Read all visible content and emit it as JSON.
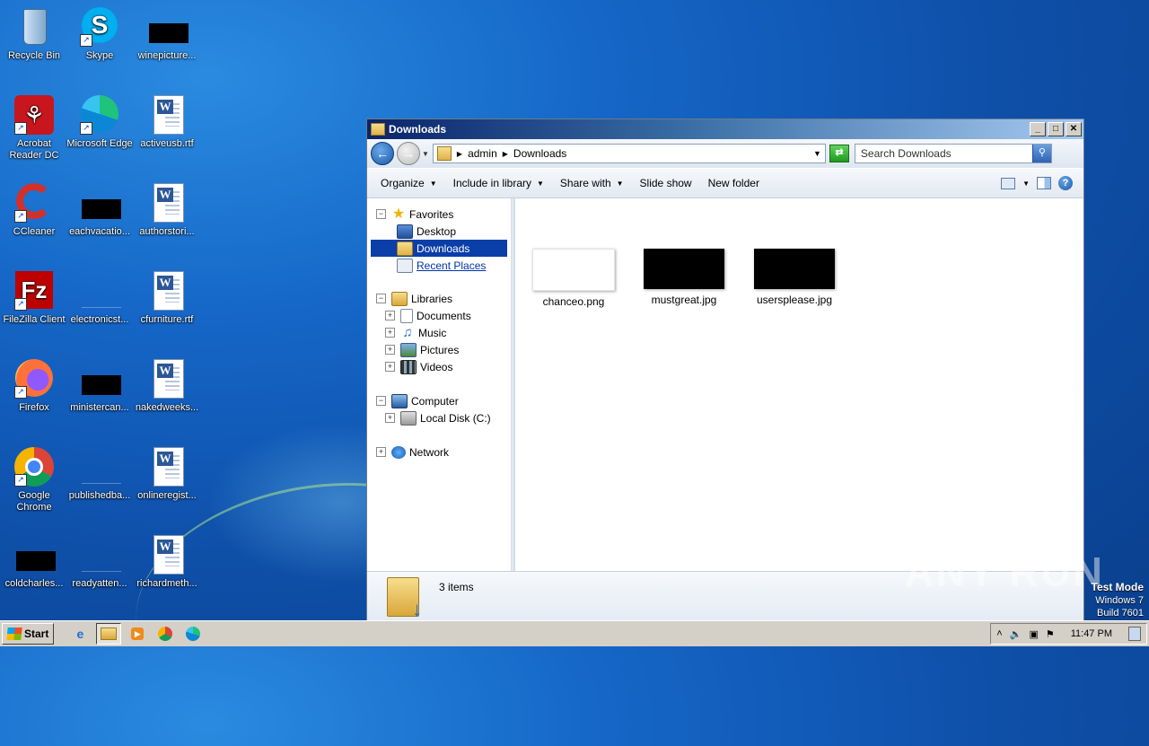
{
  "desktop": {
    "icons": [
      {
        "label": "Recycle Bin"
      },
      {
        "label": "Skype"
      },
      {
        "label": "winepicture..."
      },
      {
        "label": "Acrobat Reader DC"
      },
      {
        "label": "Microsoft Edge"
      },
      {
        "label": "activeusb.rtf"
      },
      {
        "label": "CCleaner"
      },
      {
        "label": "eachvacatio..."
      },
      {
        "label": "authorstori..."
      },
      {
        "label": "FileZilla Client"
      },
      {
        "label": "electronicst..."
      },
      {
        "label": "cfurniture.rtf"
      },
      {
        "label": "Firefox"
      },
      {
        "label": "ministercan..."
      },
      {
        "label": "nakedweeks..."
      },
      {
        "label": "Google Chrome"
      },
      {
        "label": "publishedba..."
      },
      {
        "label": "onlineregist..."
      },
      {
        "label": "coldcharles..."
      },
      {
        "label": "readyatten..."
      },
      {
        "label": "richardmeth..."
      }
    ]
  },
  "window": {
    "title": "Downloads",
    "breadcrumb": [
      "admin",
      "Downloads"
    ],
    "search_placeholder": "Search Downloads",
    "toolbar": {
      "organize": "Organize",
      "include": "Include in library",
      "share": "Share with",
      "slideshow": "Slide show",
      "newfolder": "New folder"
    },
    "nav": {
      "favorites": "Favorites",
      "desktop": "Desktop",
      "downloads": "Downloads",
      "recent": "Recent Places",
      "libraries": "Libraries",
      "documents": "Documents",
      "music": "Music",
      "pictures": "Pictures",
      "videos": "Videos",
      "computer": "Computer",
      "localdisk": "Local Disk (C:)",
      "network": "Network"
    },
    "files": [
      {
        "name": "chanceo.png"
      },
      {
        "name": "mustgreat.jpg"
      },
      {
        "name": "usersplease.jpg"
      }
    ],
    "status": "3 items"
  },
  "taskbar": {
    "start": "Start",
    "clock": "11:47 PM"
  },
  "watermark": "ANY RUN",
  "testmode": {
    "line1": "Test Mode",
    "line2": "Windows 7",
    "line3": "Build 7601"
  }
}
